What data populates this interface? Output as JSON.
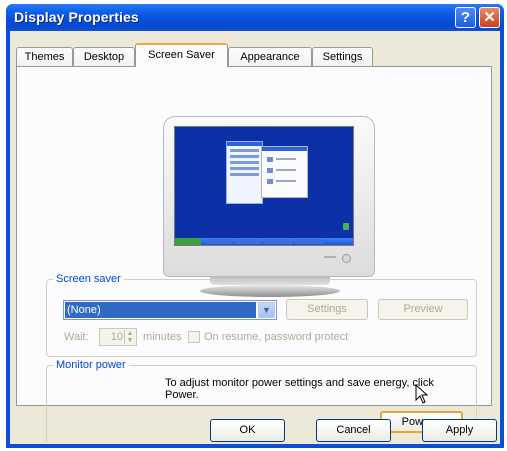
{
  "window": {
    "title": "Display Properties",
    "help_glyph": "?",
    "close_glyph": "✕"
  },
  "tabs": [
    {
      "label": "Themes",
      "active": false
    },
    {
      "label": "Desktop",
      "active": false
    },
    {
      "label": "Screen Saver",
      "active": true
    },
    {
      "label": "Appearance",
      "active": false
    },
    {
      "label": "Settings",
      "active": false
    }
  ],
  "screen_saver": {
    "group_label": "Screen saver",
    "selected": "(None)",
    "settings_button": "Settings",
    "preview_button": "Preview",
    "wait_label": "Wait:",
    "wait_value": "10",
    "minutes_label": "minutes",
    "resume_label": "On resume, password protect"
  },
  "monitor_power": {
    "group_label": "Monitor power",
    "description": "To adjust monitor power settings and save energy, click Power.",
    "power_button": "Power..."
  },
  "buttons": {
    "ok": "OK",
    "cancel": "Cancel",
    "apply": "Apply"
  },
  "colors": {
    "title_bar": "#0648d0",
    "dialog_bg": "#ece9d8",
    "selection": "#316ac5",
    "group_label": "#0046d5"
  }
}
